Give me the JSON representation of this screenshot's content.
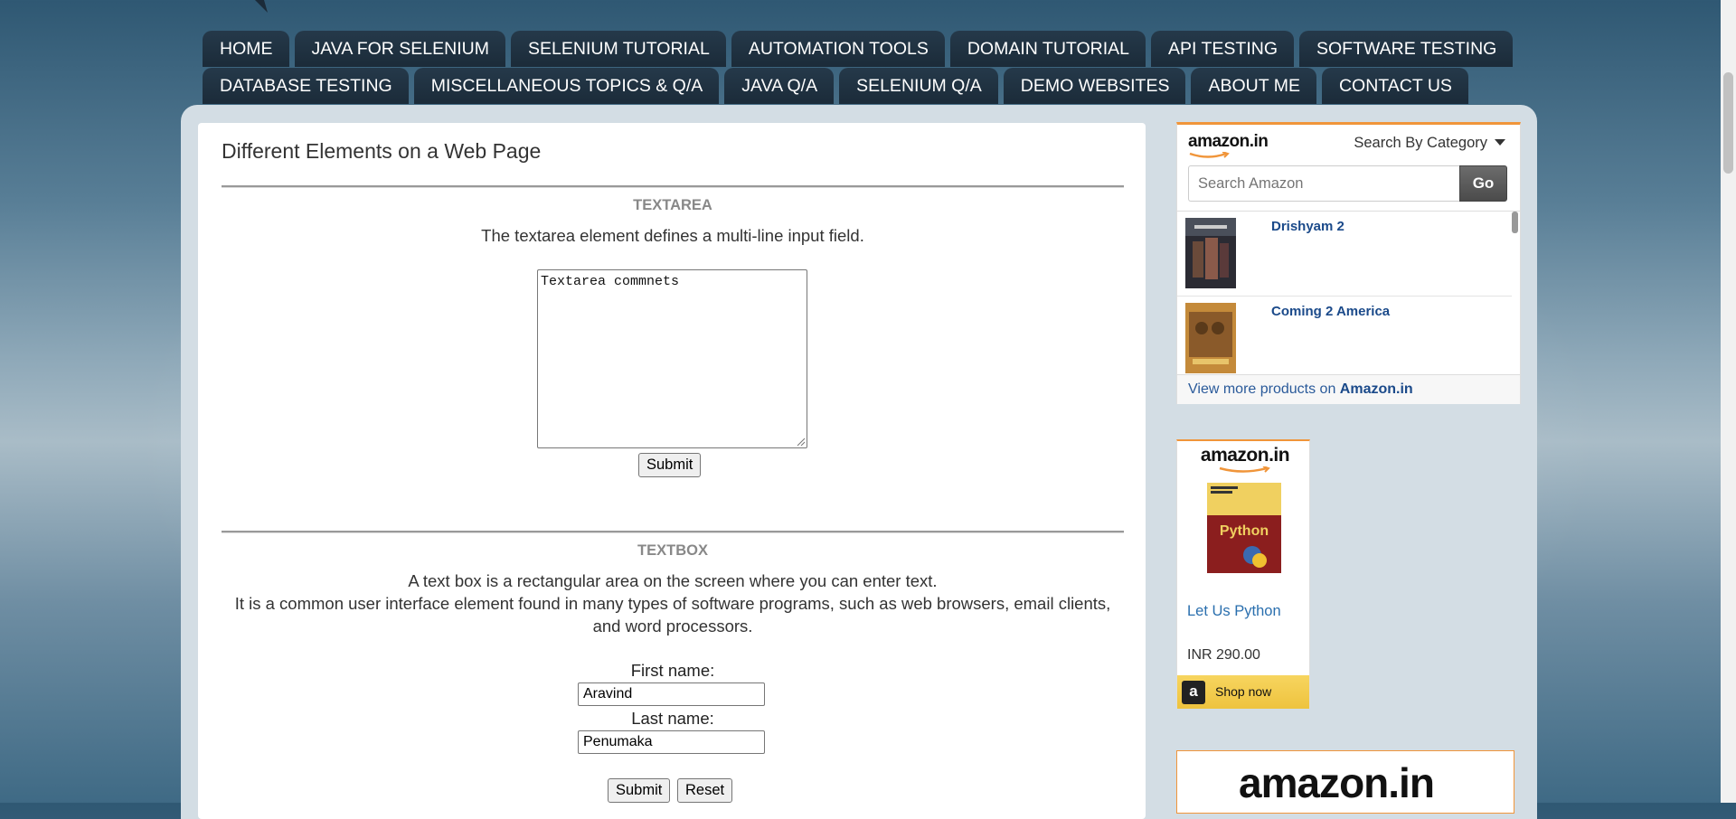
{
  "nav": {
    "row1": [
      "HOME",
      "JAVA FOR SELENIUM",
      "SELENIUM TUTORIAL",
      "AUTOMATION TOOLS",
      "DOMAIN TUTORIAL",
      "API TESTING",
      "SOFTWARE TESTING"
    ],
    "row2": [
      "DATABASE TESTING",
      "MISCELLANEOUS TOPICS & Q/A",
      "JAVA Q/A",
      "SELENIUM Q/A",
      "DEMO WEBSITES",
      "ABOUT ME",
      "CONTACT US"
    ]
  },
  "main": {
    "title": "Different Elements on a Web Page",
    "textarea_section": {
      "heading": "TEXTAREA",
      "description": "The textarea element defines a multi-line input field.",
      "textarea_value": "Textarea commnets",
      "submit_label": "Submit"
    },
    "textbox_section": {
      "heading": "TEXTBOX",
      "description_line1": "A text box is a rectangular area on the screen where you can enter text.",
      "description_line2": "It is a common user interface element found in many types of software programs, such as web browsers, email clients,",
      "description_line3": "and word processors.",
      "first_name_label": "First name:",
      "first_name_value": "Aravind",
      "last_name_label": "Last name:",
      "last_name_value": "Penumaka",
      "submit_label": "Submit",
      "reset_label": "Reset"
    }
  },
  "amazon_widget": {
    "logo": "amazon.in",
    "category_label": "Search By Category",
    "search_placeholder": "Search Amazon",
    "go_label": "Go",
    "products": [
      {
        "title": "Drishyam 2",
        "thumb_icon": "drishyam-2-poster"
      },
      {
        "title": "Coming 2 America",
        "thumb_icon": "coming-2-america-poster"
      }
    ],
    "more_prefix": "View more products on",
    "more_link": "Amazon.in"
  },
  "amazon_ad": {
    "logo": "amazon.in",
    "book_title": "Let Us Python",
    "price": "INR 290.00",
    "shop_label": "Shop now",
    "shop_icon_letter": "a"
  },
  "amazon_banner": {
    "logo": "amazon.in"
  },
  "colors": {
    "nav_bg": "#1b2b39",
    "amazon_orange": "#f0953a",
    "link_blue": "#1b4a8a",
    "shop_yellow": "#eec33e"
  }
}
